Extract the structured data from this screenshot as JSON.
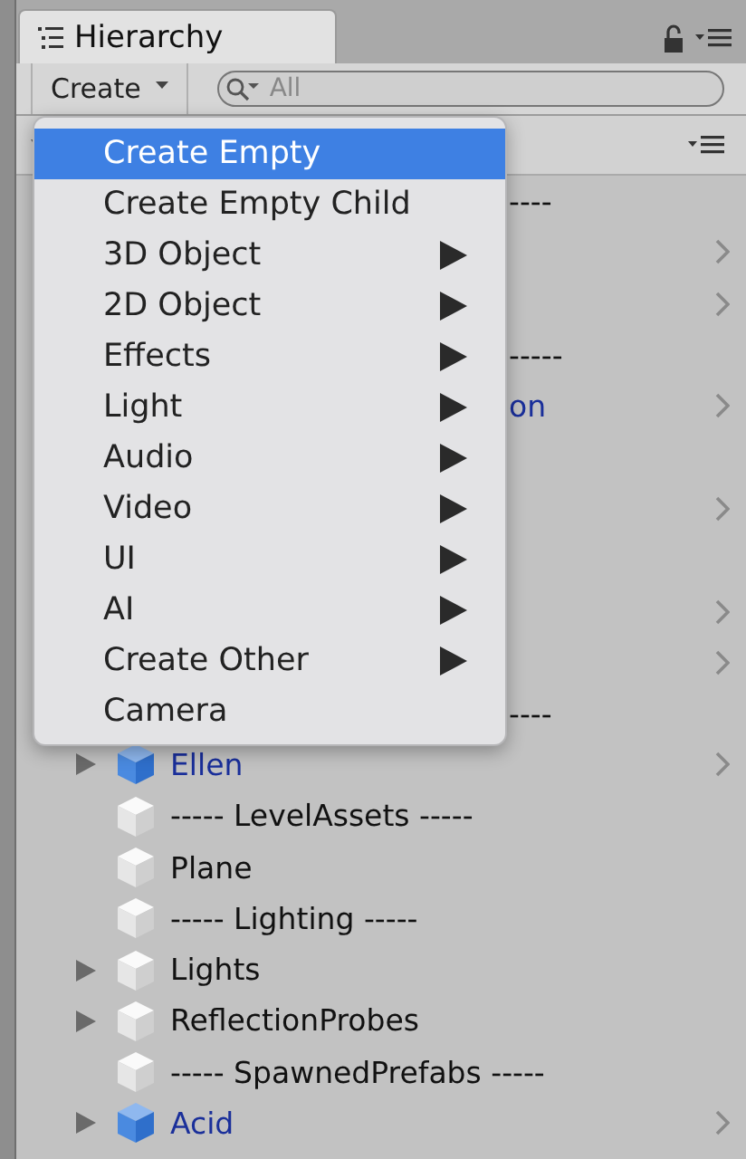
{
  "tab": {
    "title": "Hierarchy"
  },
  "toolbar": {
    "create_label": "Create",
    "search": {
      "placeholder": "All"
    }
  },
  "menu": {
    "items": [
      {
        "label": "Create Empty",
        "selected": true,
        "submenu": false
      },
      {
        "label": "Create Empty Child",
        "selected": false,
        "submenu": false
      },
      {
        "label": "3D Object",
        "selected": false,
        "submenu": true
      },
      {
        "label": "2D Object",
        "selected": false,
        "submenu": true
      },
      {
        "label": "Effects",
        "selected": false,
        "submenu": true
      },
      {
        "label": "Light",
        "selected": false,
        "submenu": true
      },
      {
        "label": "Audio",
        "selected": false,
        "submenu": true
      },
      {
        "label": "Video",
        "selected": false,
        "submenu": true
      },
      {
        "label": "UI",
        "selected": false,
        "submenu": true
      },
      {
        "label": "AI",
        "selected": false,
        "submenu": true
      },
      {
        "label": "Create Other",
        "selected": false,
        "submenu": true
      },
      {
        "label": "Camera",
        "selected": false,
        "submenu": false
      }
    ]
  },
  "rows": [
    {
      "kind": "covered",
      "label": "----",
      "prefab": false
    },
    {
      "kind": "covered",
      "prefab": true
    },
    {
      "kind": "covered",
      "prefab": true
    },
    {
      "kind": "covered",
      "label": "-----",
      "prefab": false
    },
    {
      "kind": "covered",
      "label": "on",
      "prefab": true
    },
    {
      "kind": "covered",
      "prefab": false
    },
    {
      "kind": "covered",
      "prefab": true
    },
    {
      "kind": "covered",
      "prefab": false
    },
    {
      "kind": "covered",
      "prefab": true
    },
    {
      "kind": "covered",
      "prefab": true
    },
    {
      "kind": "covered",
      "label": "----",
      "prefab": false
    },
    {
      "kind": "object",
      "label": "Ellen",
      "expandable": true,
      "prefab": true
    },
    {
      "kind": "object",
      "label": "----- LevelAssets -----",
      "expandable": false,
      "prefab": false
    },
    {
      "kind": "object",
      "label": "Plane",
      "expandable": false,
      "prefab": false
    },
    {
      "kind": "object",
      "label": "----- Lighting -----",
      "expandable": false,
      "prefab": false
    },
    {
      "kind": "object",
      "label": "Lights",
      "expandable": true,
      "prefab": false
    },
    {
      "kind": "object",
      "label": "ReflectionProbes",
      "expandable": true,
      "prefab": false
    },
    {
      "kind": "object",
      "label": "----- SpawnedPrefabs -----",
      "expandable": false,
      "prefab": false
    },
    {
      "kind": "object",
      "label": "Acid",
      "expandable": true,
      "prefab": true
    }
  ]
}
